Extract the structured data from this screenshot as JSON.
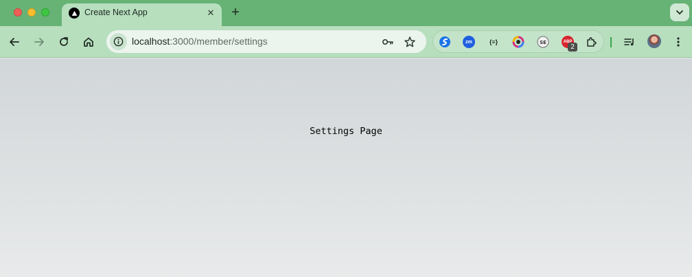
{
  "window": {
    "controls": [
      "close",
      "minimize",
      "maximize"
    ]
  },
  "tab": {
    "title": "Create Next App",
    "favicon": "nextjs-triangle-icon"
  },
  "toolbar": {
    "url_host": "localhost",
    "url_path": ":3000/member/settings",
    "extensions": [
      {
        "name": "extension-swirl",
        "color": "#1a73e8"
      },
      {
        "name": "extension-zoom",
        "color": "#1f5fe0",
        "label": "zm"
      },
      {
        "name": "extension-json",
        "color": "#2a3a2e",
        "label": "{≡}"
      },
      {
        "name": "extension-color-ring",
        "color": "#d22f7e"
      },
      {
        "name": "extension-seo",
        "color": "#6b6b6b"
      },
      {
        "name": "extension-abp",
        "color": "#d9252e",
        "label": "ABP",
        "badge": "2"
      }
    ]
  },
  "content": {
    "text": "Settings Page"
  }
}
